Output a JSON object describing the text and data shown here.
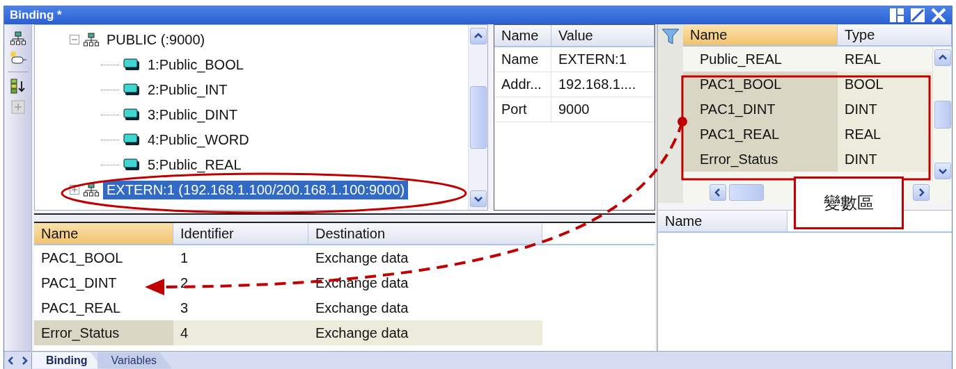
{
  "window": {
    "title": "Binding *"
  },
  "toolbar": [
    {
      "kind": "network"
    },
    {
      "kind": "connector"
    },
    {
      "kind": "sort"
    },
    {
      "kind": "add"
    }
  ],
  "tree": {
    "items": [
      {
        "label": "PUBLIC (:9000)",
        "kind": "network",
        "expanded": true,
        "selected": false,
        "children": [
          {
            "label": "1:Public_BOOL",
            "kind": "variable",
            "selected": false
          },
          {
            "label": "2:Public_INT",
            "kind": "variable",
            "selected": false
          },
          {
            "label": "3:Public_DINT",
            "kind": "variable",
            "selected": false
          },
          {
            "label": "4:Public_WORD",
            "kind": "variable",
            "selected": false
          },
          {
            "label": "5:Public_REAL",
            "kind": "variable",
            "selected": false
          }
        ]
      },
      {
        "label": "EXTERN:1 (192.168.1.100/200.168.1.100:9000)",
        "kind": "network",
        "expanded": false,
        "selected": true
      }
    ]
  },
  "properties": {
    "columns": [
      "Name",
      "Value"
    ],
    "rows": [
      {
        "name": "Name",
        "value": "EXTERN:1"
      },
      {
        "name": "Addr...",
        "value": "192.168.1...."
      },
      {
        "name": "Port",
        "value": "9000"
      }
    ]
  },
  "variables": {
    "columns": [
      {
        "label": "Name",
        "sorted": true
      },
      {
        "label": "Type",
        "sorted": false
      }
    ],
    "rows": [
      {
        "name": "Public_REAL",
        "type": "REAL",
        "highlighted": false
      },
      {
        "name": "PAC1_BOOL",
        "type": "BOOL",
        "highlighted": true
      },
      {
        "name": "PAC1_DINT",
        "type": "DINT",
        "highlighted": true
      },
      {
        "name": "PAC1_REAL",
        "type": "REAL",
        "highlighted": true
      },
      {
        "name": "Error_Status",
        "type": "DINT",
        "highlighted": true
      }
    ]
  },
  "bindings": {
    "columns": [
      {
        "label": "Name",
        "sorted": true
      },
      {
        "label": "Identifier",
        "sorted": false
      },
      {
        "label": "Destination",
        "sorted": false
      }
    ],
    "rows": [
      {
        "name": "PAC1_BOOL",
        "identifier": "1",
        "destination": "Exchange data",
        "highlighted": false
      },
      {
        "name": "PAC1_DINT",
        "identifier": "2",
        "destination": "Exchange data",
        "highlighted": false
      },
      {
        "name": "PAC1_REAL",
        "identifier": "3",
        "destination": "Exchange data",
        "highlighted": false
      },
      {
        "name": "Error_Status",
        "identifier": "4",
        "destination": "Exchange data",
        "highlighted": true
      }
    ]
  },
  "members": {
    "columns": [
      "Name"
    ]
  },
  "callout": {
    "text": "變數區"
  },
  "tabs": [
    {
      "label": "Binding",
      "selected": true
    },
    {
      "label": "Variables",
      "selected": false
    }
  ]
}
